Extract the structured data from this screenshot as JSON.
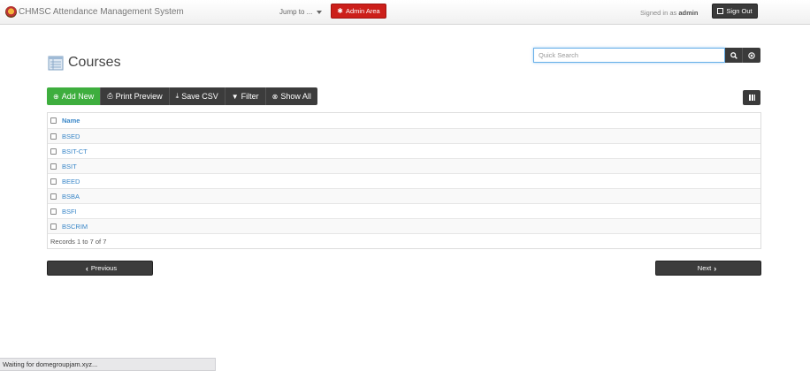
{
  "navbar": {
    "app_title": "CHMSC Attendance Management System",
    "jump_label": "Jump to ...",
    "admin_label": "Admin Area",
    "signed_prefix": "Signed in as",
    "signed_user": "admin",
    "signout_label": "Sign Out"
  },
  "page": {
    "title": "Courses"
  },
  "search": {
    "placeholder": "Quick Search",
    "value": ""
  },
  "toolbar": {
    "add_label": "Add New",
    "print_label": "Print Preview",
    "csv_label": "Save CSV",
    "filter_label": "Filter",
    "showall_label": "Show All"
  },
  "table": {
    "header": "Name",
    "rows": [
      "BSED",
      "BSIT-CT",
      "BSIT",
      "BEED",
      "BSBA",
      "BSFI",
      "BSCRIM"
    ],
    "records_text": "Records 1 to 7 of 7"
  },
  "pager": {
    "previous_label": "Previous",
    "next_label": "Next"
  },
  "status": {
    "text": "Waiting for domegroupjam.xyz..."
  },
  "colors": {
    "accent_green": "#3eae3e",
    "admin_red": "#cc1f1a",
    "dark_button": "#3c3c3c",
    "link_blue": "#3a87c8"
  }
}
